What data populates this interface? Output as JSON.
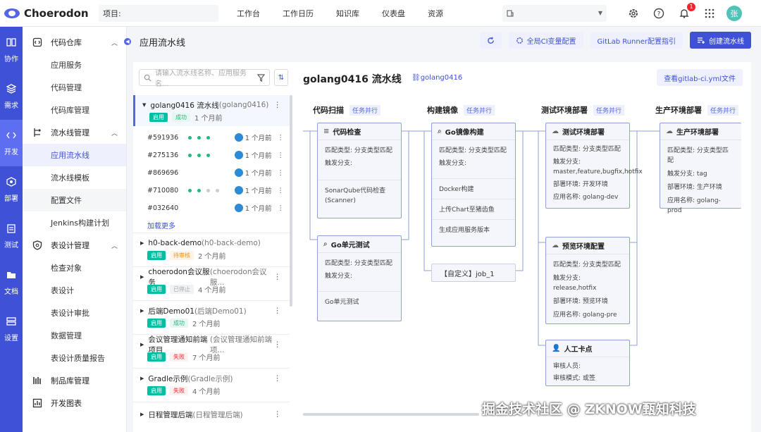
{
  "app": {
    "name": "Choerodon",
    "avatar": "张",
    "notification_count": "1"
  },
  "topbar": {
    "project_label": "项目:",
    "nav": [
      "工作台",
      "工作日历",
      "知识库",
      "仪表盘",
      "资源"
    ],
    "branch_value": ""
  },
  "leftbar": [
    {
      "label": "协作",
      "icon": "collab-icon"
    },
    {
      "label": "需求",
      "icon": "layers-icon"
    },
    {
      "label": "开发",
      "icon": "code-icon",
      "active": true
    },
    {
      "label": "部署",
      "icon": "deploy-icon"
    },
    {
      "label": "测试",
      "icon": "clipboard-icon"
    },
    {
      "label": "文档",
      "icon": "folder-icon"
    },
    {
      "label": "设置",
      "icon": "server-icon"
    }
  ],
  "menu": {
    "groups": [
      {
        "label": "代码仓库",
        "items": [
          "应用服务",
          "代码管理",
          "代码库管理"
        ]
      },
      {
        "label": "流水线管理",
        "items": [
          "应用流水线",
          "流水线模板",
          "配置文件",
          "Jenkins构建计划"
        ]
      },
      {
        "label": "表设计管理",
        "items": [
          "检查对象",
          "表设计",
          "表设计审批",
          "数据管理",
          "表设计质量报告"
        ]
      },
      {
        "label": "制品库管理",
        "items": []
      },
      {
        "label": "开发图表",
        "items": []
      }
    ]
  },
  "page": {
    "title": "应用流水线"
  },
  "header_buttons": {
    "refresh": "",
    "ci_vars": "全局CI变量配置",
    "runner": "GitLab Runner配置指引",
    "create": "创建流水线"
  },
  "search": {
    "placeholder": "请输入流水线名称、应用服务名..."
  },
  "pipelines": [
    {
      "name": "golang0416 流水线",
      "code": "(golang0416)",
      "status": "成功",
      "time": "1 个月前",
      "selected": true
    },
    {
      "name": "h0-back-demo",
      "code": "(h0-back-demo)",
      "status": "待审核",
      "time": "2 个月前"
    },
    {
      "name": "choerodon会议服务",
      "code": "(choerodon会议服...",
      "status": "已停止",
      "time": "4 个月前"
    },
    {
      "name": "后端Demo01",
      "code": "(后端Demo01)",
      "status": "成功",
      "time": "2 个月前"
    },
    {
      "name": "会议管理通知前端项目",
      "code": "(会议管理通知前端项...",
      "status": "失败",
      "time": "7 个月前"
    },
    {
      "name": "Gradle示例",
      "code": "(Gradle示例)",
      "status": "失败",
      "time": "4 个月前"
    },
    {
      "name": "日程管理后端",
      "code": "(日程管理后端)",
      "status": "",
      "time": ""
    }
  ],
  "app_tag": "启用",
  "runs": [
    {
      "id": "#591936",
      "time": "1 个月前",
      "dots": [
        "#1fb97a",
        "#1fb97a",
        "#1fb97a"
      ]
    },
    {
      "id": "#275136",
      "time": "1 个月前",
      "dots": [
        "#1fb97a",
        "#1fb97a",
        "#1fb97a"
      ]
    },
    {
      "id": "#869696",
      "time": "1 个月前",
      "dots": []
    },
    {
      "id": "#710080",
      "time": "1 个月前",
      "dots": [
        "#1fb97a",
        "#1fb97a",
        "#c8ccd6",
        "#c8ccd6"
      ]
    },
    {
      "id": "#032640",
      "time": "1 个月前",
      "dots": []
    }
  ],
  "load_more": "加载更多",
  "detail": {
    "title": "golang0416 流水线",
    "code": "golang0416",
    "yml_button": "查看gitlab-ci.yml文件",
    "parallel_tag": "任务并行",
    "stages": [
      {
        "name": "代码扫描",
        "jobs": [
          {
            "title": "代码检查",
            "lines": [
              "匹配类型: 分支类型匹配",
              "触发分支:"
            ],
            "steps": [
              "SonarQube代码检查",
              "(Scanner)"
            ]
          },
          {
            "title": "Go单元测试",
            "lines": [
              "匹配类型: 分支类型匹配",
              "触发分支:"
            ],
            "steps": [
              "Go单元测试"
            ]
          }
        ]
      },
      {
        "name": "构建镜像",
        "jobs": [
          {
            "title": "Go镜像构建",
            "lines": [
              "匹配类型: 分支类型匹配",
              "触发分支:"
            ],
            "steps": [
              "Docker构建",
              "上传Chart至猪齿鱼",
              "生成应用服务版本"
            ]
          },
          {
            "title": "【自定义】job_1",
            "lines": [],
            "steps": []
          }
        ]
      },
      {
        "name": "测试环境部署",
        "jobs": [
          {
            "title": "测试环境部署",
            "lines": [
              "匹配类型: 分支类型匹配",
              "触发分支: master,feature,bugfix,hotfix",
              "部署环境: 开发环境",
              "应用名称: golang-dev"
            ],
            "steps": []
          },
          {
            "title": "预览环境配置",
            "lines": [
              "匹配类型: 分支类型匹配",
              "触发分支: release,hotfix",
              "部署环境: 预览环境",
              "应用名称: golang-pre"
            ],
            "steps": []
          },
          {
            "title": "人工卡点",
            "lines": [
              "审核人员:",
              "审核模式: 或签"
            ],
            "steps": []
          }
        ]
      },
      {
        "name": "生产环境部署",
        "jobs": [
          {
            "title": "生产环境部署",
            "lines": [
              "匹配类型: 分支类型匹配",
              "触发分支: tag",
              "部署环境: 生产环境",
              "应用名称: golang-prod"
            ],
            "steps": []
          }
        ]
      }
    ]
  },
  "watermark": "掘金技术社区 @ ZKNOW甄知科技",
  "colors": {
    "accent": "#3f51d6",
    "success": "#1fb97a",
    "warn": "#fa8c16",
    "fail": "#f5222d",
    "app_tag": "#00bfa5"
  }
}
